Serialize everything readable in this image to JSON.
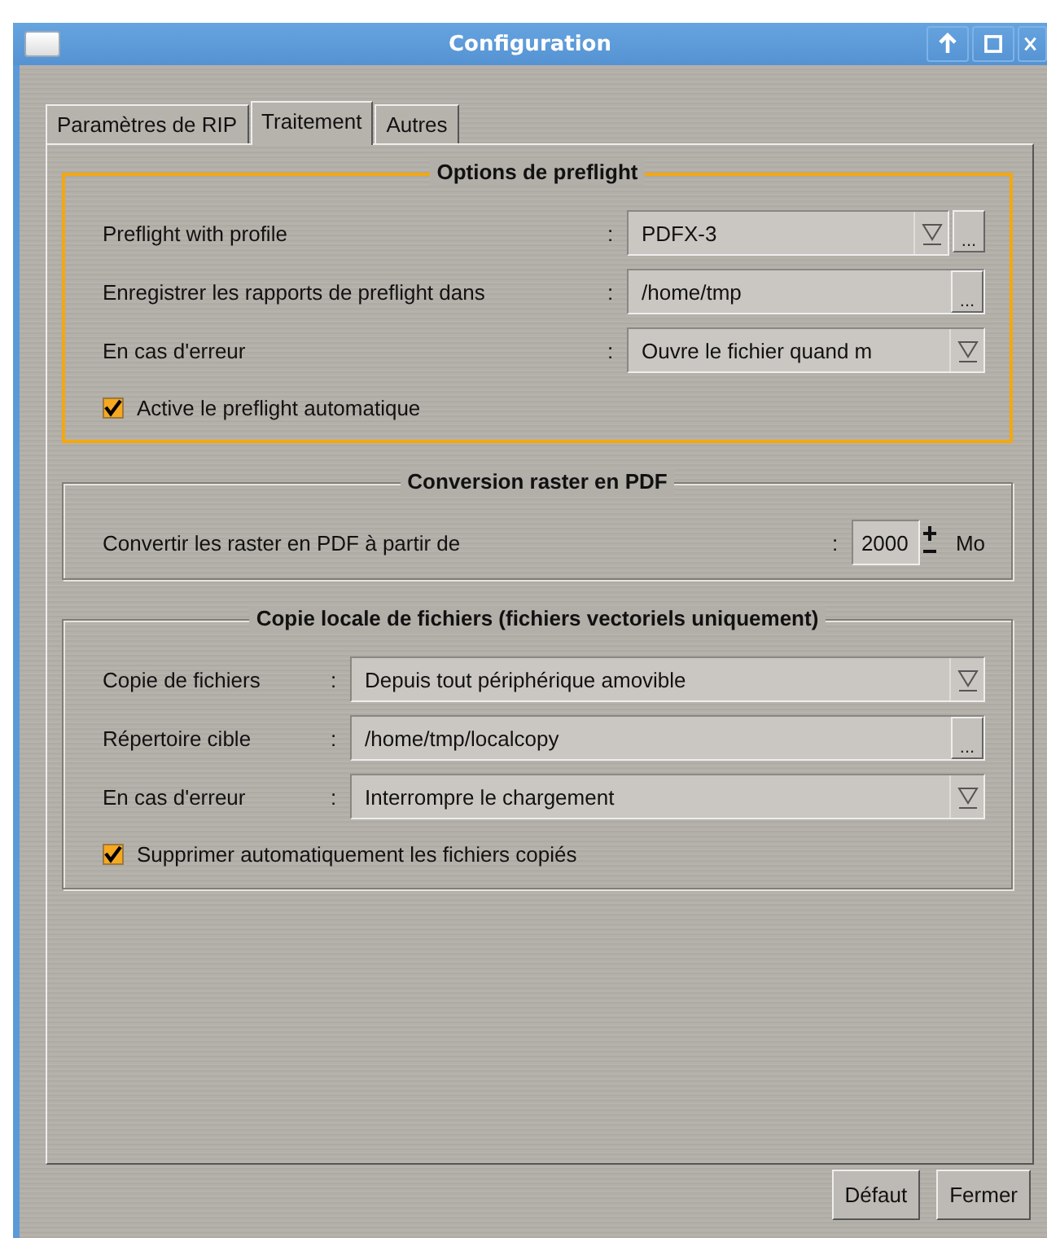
{
  "window": {
    "title": "Configuration"
  },
  "tabs": [
    {
      "label": "Paramètres de RIP",
      "selected": false
    },
    {
      "label": "Traitement",
      "selected": true
    },
    {
      "label": "Autres",
      "selected": false
    }
  ],
  "groups": [
    {
      "title": "Options de preflight",
      "focused": true,
      "rows": [
        {
          "kind": "combo_browse",
          "label": "Preflight with profile",
          "separator": ":",
          "value": "PDFX-3",
          "browse": "..."
        },
        {
          "kind": "path",
          "label": "Enregistrer les rapports de preflight dans",
          "separator": ":",
          "value": "/home/tmp",
          "browse": "..."
        },
        {
          "kind": "combo",
          "label": "En cas d'erreur",
          "separator": ":",
          "value": "Ouvre le fichier quand m"
        }
      ],
      "checkbox": {
        "label": "Active le preflight automatique",
        "checked": true
      }
    },
    {
      "title": "Conversion raster en PDF",
      "focused": false,
      "rows": [
        {
          "kind": "spin",
          "label": "Convertir les raster en PDF à partir de",
          "separator": ":",
          "value": "2000",
          "unit": "Mo"
        }
      ]
    },
    {
      "title": "Copie locale de fichiers (fichiers vectoriels uniquement)",
      "focused": false,
      "rows": [
        {
          "kind": "combo",
          "label": "Copie de fichiers",
          "separator": ":",
          "value": "Depuis tout périphérique amovible"
        },
        {
          "kind": "path",
          "label": "Répertoire cible",
          "separator": ":",
          "value": "/home/tmp/localcopy",
          "browse": "..."
        },
        {
          "kind": "combo",
          "label": "En cas d'erreur",
          "separator": ":",
          "value": "Interrompre le chargement"
        }
      ],
      "checkbox": {
        "label": "Supprimer automatiquement les fichiers copiés",
        "checked": true
      }
    }
  ],
  "buttons": [
    "Défaut",
    "Fermer"
  ]
}
